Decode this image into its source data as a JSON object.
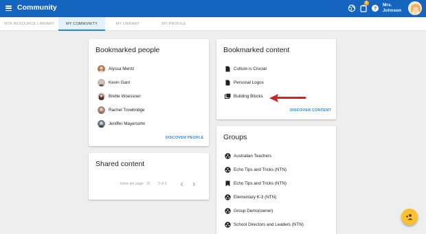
{
  "header": {
    "title": "Community",
    "user_name": "Mrs. Johnson",
    "notification_count": "1"
  },
  "tabs": [
    {
      "label": "NTN RESOURCE LIBRARY",
      "active": false
    },
    {
      "label": "MY COMMUNITY",
      "active": true
    },
    {
      "label": "MY LIBRARY",
      "active": false
    },
    {
      "label": "MY PROFILE",
      "active": false
    }
  ],
  "bookmarked_people": {
    "title": "Bookmarked people",
    "people": [
      {
        "name": "Alyssa Mentz",
        "avatar_color": "#b07a52"
      },
      {
        "name": "Kevin Gant",
        "avatar_color": "#8d8d8d"
      },
      {
        "name": "Brette Woessner",
        "avatar_color": "#6d4c3d"
      },
      {
        "name": "Rachel Trowbridge",
        "avatar_color": "#9c8a7a"
      },
      {
        "name": "Jeniffer Mayersohn",
        "avatar_color": "#5d7f9e"
      }
    ],
    "link": "DISCOVER PEOPLE"
  },
  "shared_content": {
    "title": "Shared content",
    "items_per_page_label": "Items per page:",
    "items_per_page_value": "25",
    "range": "0 of 0"
  },
  "bookmarked_content": {
    "title": "Bookmarked content",
    "items": [
      {
        "label": "Culture is Crucial",
        "icon": "document-icon"
      },
      {
        "label": "Personal Logos",
        "icon": "document-icon"
      },
      {
        "label": "Building Blocks",
        "icon": "collection-icon"
      }
    ],
    "link": "DISCOVER CONTENT"
  },
  "groups": {
    "title": "Groups",
    "items": [
      {
        "label": "Australian Teachers",
        "icon": "group-icon"
      },
      {
        "label": "Echo Tips and Tricks (NTN)",
        "icon": "group-icon"
      },
      {
        "label": "Echo Tips and Tricks (NTN)",
        "icon": "bookmark-icon"
      },
      {
        "label": "Elementary K-3 (NTN)",
        "icon": "group-icon"
      },
      {
        "label": "Group Demo(owner)",
        "icon": "group-icon"
      },
      {
        "label": "School Directors and Leaders (NTN)",
        "icon": "group-icon"
      }
    ]
  },
  "colors": {
    "appbar": "#1565c0",
    "accent": "#1e88e5",
    "arrow": "#c62828",
    "fab": "#fbc02d"
  }
}
